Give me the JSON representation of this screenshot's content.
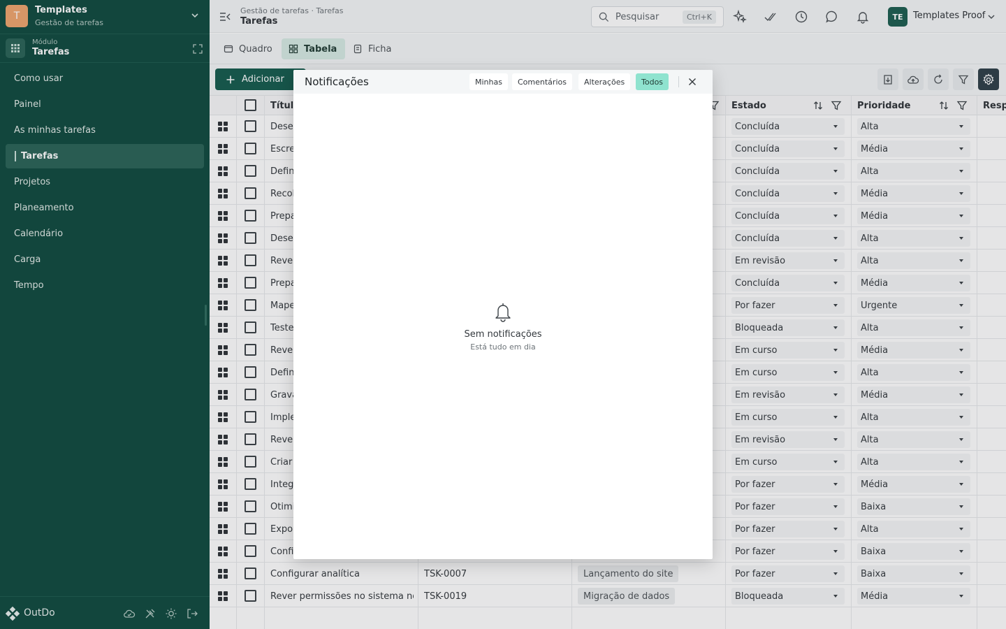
{
  "workspace": {
    "initial": "T",
    "name": "Templates",
    "subtitle": "Gestão de tarefas"
  },
  "module": {
    "label": "Módulo",
    "name": "Tarefas"
  },
  "sidebar": {
    "items": [
      {
        "label": "Como usar"
      },
      {
        "label": "Painel"
      },
      {
        "label": "As minhas tarefas"
      },
      {
        "label": "Tarefas"
      },
      {
        "label": "Projetos"
      },
      {
        "label": "Planeamento"
      },
      {
        "label": "Calendário"
      },
      {
        "label": "Carga"
      },
      {
        "label": "Tempo"
      }
    ],
    "active_index": 3
  },
  "brand": {
    "name": "OutDo"
  },
  "header": {
    "breadcrumb": "Gestão de tarefas · Tarefas",
    "title": "Tarefas",
    "search_placeholder": "Pesquisar",
    "search_shortcut": "Ctrl+K",
    "user_initials": "TE",
    "user_name": "Templates Proof"
  },
  "view_tabs": [
    {
      "label": "Quadro",
      "icon": "board-icon"
    },
    {
      "label": "Tabela",
      "icon": "table-icon"
    },
    {
      "label": "Ficha",
      "icon": "form-icon"
    }
  ],
  "active_view": "Tabela",
  "toolbar": {
    "add_label": "Adicionar"
  },
  "table": {
    "columns": {
      "title": "Título",
      "status": "Estado",
      "priority": "Prioridade",
      "assignee": "Respo"
    },
    "rows": [
      {
        "title": "Desen",
        "status": "Concluída",
        "priority": "Alta"
      },
      {
        "title": "Escre",
        "status": "Concluída",
        "priority": "Média"
      },
      {
        "title": "Defin",
        "status": "Concluída",
        "priority": "Alta"
      },
      {
        "title": "Recol",
        "status": "Concluída",
        "priority": "Média"
      },
      {
        "title": "Prepa",
        "status": "Concluída",
        "priority": "Média"
      },
      {
        "title": "Desen",
        "status": "Concluída",
        "priority": "Alta"
      },
      {
        "title": "Rever",
        "status": "Em revisão",
        "priority": "Alta"
      },
      {
        "title": "Prepa",
        "status": "Concluída",
        "priority": "Média"
      },
      {
        "title": "Mape",
        "status": "Por fazer",
        "priority": "Urgente"
      },
      {
        "title": "Teste",
        "status": "Bloqueada",
        "priority": "Alta"
      },
      {
        "title": "Rever",
        "status": "Em curso",
        "priority": "Média"
      },
      {
        "title": "Defin",
        "status": "Em curso",
        "priority": "Alta"
      },
      {
        "title": "Grava",
        "status": "Em revisão",
        "priority": "Média"
      },
      {
        "title": "Imple",
        "status": "Em curso",
        "priority": "Alta"
      },
      {
        "title": "Rever",
        "status": "Em revisão",
        "priority": "Alta"
      },
      {
        "title": "Criar",
        "status": "Em curso",
        "priority": "Alta"
      },
      {
        "title": "Integ",
        "status": "Por fazer",
        "priority": "Média"
      },
      {
        "title": "Otimi",
        "status": "Por fazer",
        "priority": "Baixa"
      },
      {
        "title": "Expor",
        "status": "Por fazer",
        "priority": "Alta"
      },
      {
        "title": "Confi",
        "status": "Por fazer",
        "priority": "Baixa"
      },
      {
        "title": "Configurar analítica",
        "id": "TSK-0007",
        "project": "Lançamento do site",
        "status": "Por fazer",
        "priority": "Baixa"
      },
      {
        "title": "Rever permissões no sistema no...",
        "id": "TSK-0019",
        "project": "Migração de dados",
        "status": "Bloqueada",
        "priority": "Média"
      }
    ]
  },
  "notifications": {
    "title": "Notificações",
    "tabs": [
      "Minhas",
      "Comentários",
      "Alterações",
      "Todos"
    ],
    "active_tab": "Todos",
    "empty_title": "Sem notificações",
    "empty_subtitle": "Está tudo em dia"
  }
}
